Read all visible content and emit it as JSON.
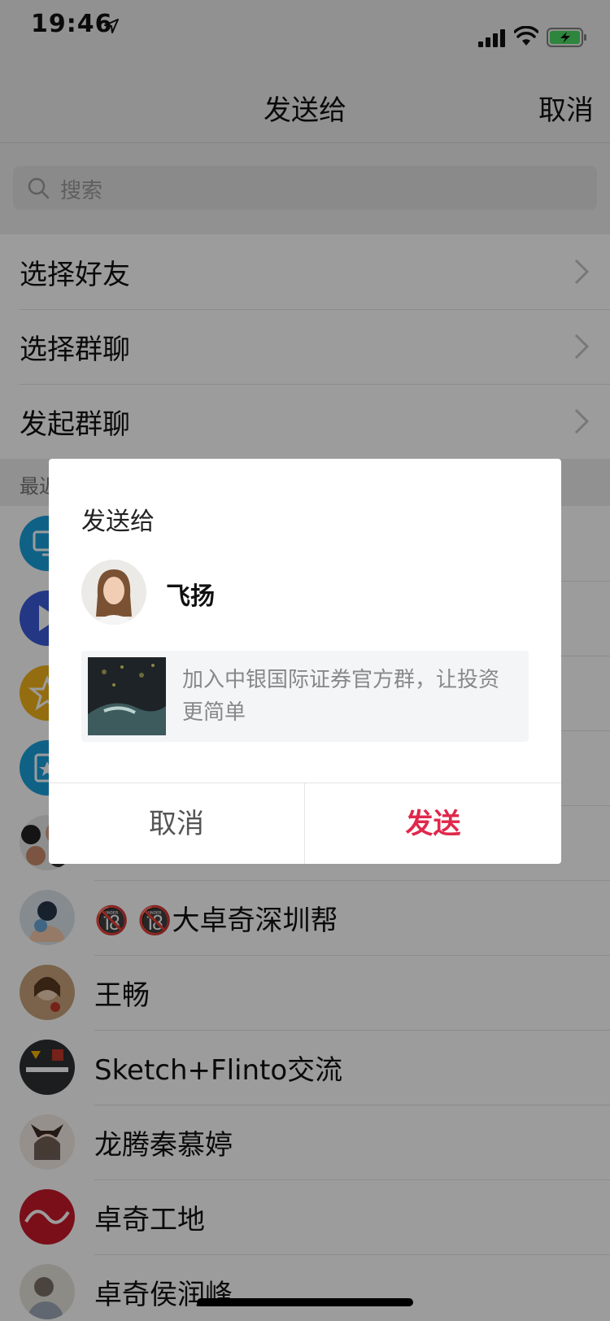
{
  "status": {
    "time": "19:46"
  },
  "nav": {
    "title": "发送给",
    "cancel": "取消"
  },
  "search": {
    "placeholder": "搜索"
  },
  "menu": [
    {
      "label": "选择好友"
    },
    {
      "label": "选择群聊"
    },
    {
      "label": "发起群聊"
    }
  ],
  "section": {
    "label": "最近聊天"
  },
  "recent": [
    {
      "name": ""
    },
    {
      "name": ""
    },
    {
      "name": ""
    },
    {
      "name": ""
    },
    {
      "name": ""
    },
    {
      "name": "🔞 🔞大卓奇深圳帮"
    },
    {
      "name": "王畅"
    },
    {
      "name": "Sketch+Flinto交流"
    },
    {
      "name": "龙腾秦慕婷"
    },
    {
      "name": "卓奇工地"
    },
    {
      "name": "卓奇侯润峰"
    }
  ],
  "dialog": {
    "title": "发送给",
    "recipient": "飞扬",
    "message": "加入中银国际证券官方群，让投资更简单",
    "cancel": "取消",
    "send": "发送"
  },
  "colors": {
    "send": "#e0284b",
    "battery": "#4cd964"
  }
}
